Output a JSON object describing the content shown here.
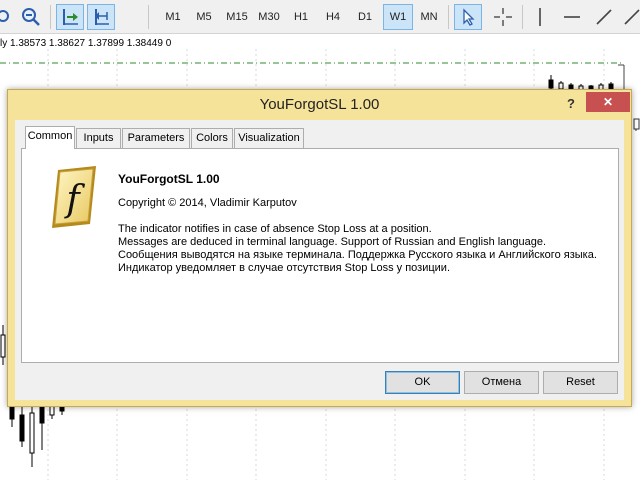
{
  "toolbar": {
    "timeframes": [
      "M1",
      "M5",
      "M15",
      "M30",
      "H1",
      "H4",
      "D1",
      "W1",
      "MN"
    ],
    "active_timeframe": "W1"
  },
  "chart": {
    "price_line": "ly  1.38573  1.38627  1.37899  1.38449  0"
  },
  "dialog": {
    "title": "YouForgotSL 1.00",
    "help_label": "?",
    "close_label": "✕",
    "tabs": [
      {
        "label": "Common",
        "selected": true
      },
      {
        "label": "Inputs",
        "selected": false
      },
      {
        "label": "Parameters",
        "selected": false
      },
      {
        "label": "Colors",
        "selected": false
      },
      {
        "label": "Visualization",
        "selected": false
      }
    ],
    "icon_glyph": "f",
    "app_name": "YouForgotSL 1.00",
    "copyright": "Copyright © 2014, Vladimir Karputov",
    "description": [
      "The indicator notifies in case of absence Stop Loss at a position.",
      "Messages are deduced in terminal language. Support of Russian and English language.",
      "Сообщения выводятся на языке терминала. Поддержка Русского языка и Английского языка.",
      "Индикатор уведомляет в случае отсутствия Stop Loss у позиции."
    ],
    "buttons": {
      "ok": "OK",
      "cancel": "Отмена",
      "reset": "Reset"
    }
  },
  "colors": {
    "dialog_frame": "#f6e39a",
    "close_button": "#c75050",
    "level_line": "#2e8b2e"
  }
}
